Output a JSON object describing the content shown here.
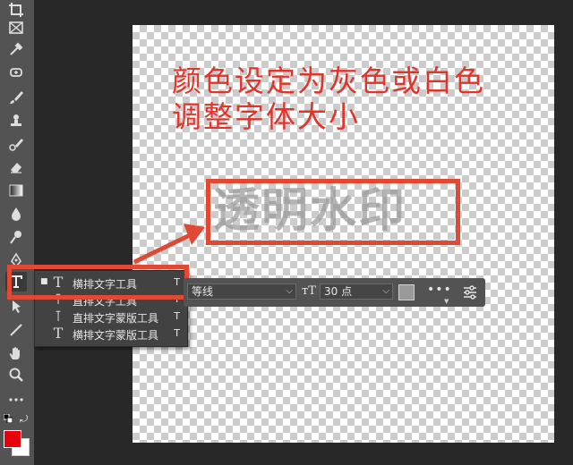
{
  "canvas": {
    "instruction_line1": "颜色设定为灰色或白色",
    "instruction_line2": "调整字体大小",
    "watermark_text": "透明水印"
  },
  "tool_flyout": {
    "items": [
      {
        "label": "横排文字工具",
        "shortcut": "T",
        "icon": "type-horizontal-icon",
        "selected": true
      },
      {
        "label": "直排文字工具",
        "shortcut": "T",
        "icon": "type-vertical-icon",
        "selected": false
      },
      {
        "label": "直排文字蒙版工具",
        "shortcut": "T",
        "icon": "type-vertical-mask-icon",
        "selected": false
      },
      {
        "label": "横排文字蒙版工具",
        "shortcut": "T",
        "icon": "type-horizontal-mask-icon",
        "selected": false
      }
    ]
  },
  "options_bar": {
    "font_family": "等线",
    "font_size": "30 点",
    "text_color": "#9a9a9a",
    "more_label": "•••"
  },
  "colors": {
    "foreground": "#e8000b",
    "background": "#ffffff",
    "annotation": "#e04a35"
  }
}
